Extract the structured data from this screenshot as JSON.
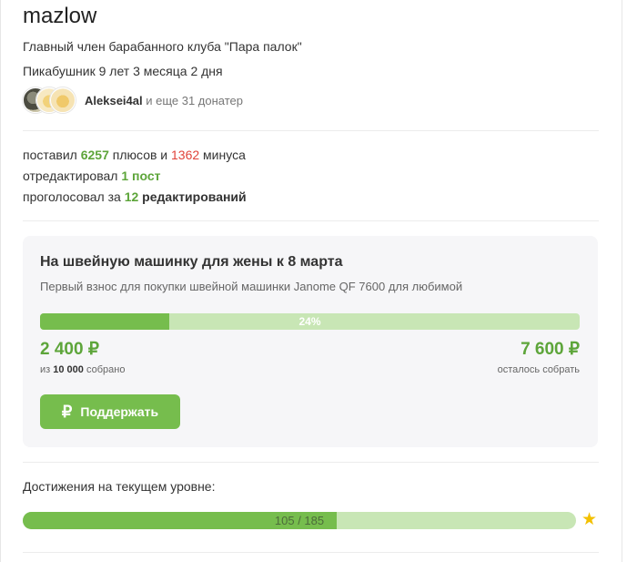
{
  "profile": {
    "username": "mazlow",
    "subtitle": "Главный член барабанного клуба \"Пара палок\"",
    "tenure": "Пикабушник 9 лет 3 месяца 2 дня",
    "donators": {
      "top_name": "Aleksei4al",
      "rest_text": " и еще 31 донатер"
    }
  },
  "stats": {
    "line1": {
      "prefix": "поставил ",
      "plus_count": "6257",
      "mid": " плюсов и ",
      "minus_count": "1362",
      "suffix": " минуса"
    },
    "line2": {
      "prefix": "отредактировал ",
      "count": "1 пост"
    },
    "line3": {
      "prefix": "проголосовал за ",
      "count": "12",
      "suffix": " редактирований"
    }
  },
  "donation": {
    "title": "На швейную машинку для жены к 8 марта",
    "description": "Первый взнос для покупки швейной машинки Janome QF 7600 для любимой",
    "progress_fraction": 0.24,
    "progress_label": "24%",
    "collected": "2 400 ₽",
    "collected_sub_prefix": "из ",
    "collected_sub_goal": "10 000",
    "collected_sub_suffix": " собрано",
    "remaining": "7 600 ₽",
    "remaining_sub": "осталось собрать",
    "button_label": "Поддержать",
    "button_icon": "₽"
  },
  "achievements": {
    "title": "Достижения на текущем уровне:",
    "current": 105,
    "total": 185,
    "label": "105 / 185",
    "star_icon": "★"
  },
  "colors": {
    "accent_green": "#76bd4d",
    "text_green": "#5da53a",
    "minus_red": "#e0433a",
    "progress_track": "#c8e6b5",
    "star": "#f3c000"
  }
}
